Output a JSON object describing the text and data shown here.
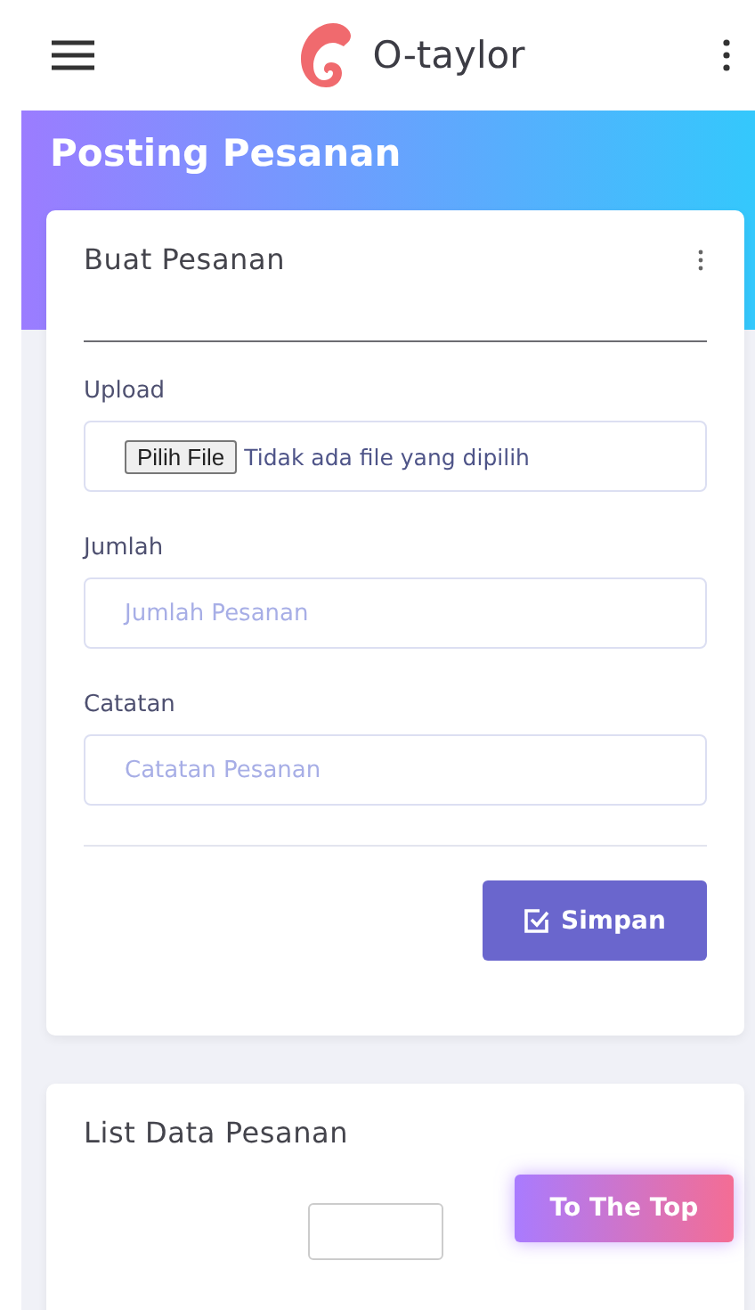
{
  "app_bar": {
    "brand": "O-taylor"
  },
  "page_title": "Posting Pesanan",
  "form_card": {
    "title": "Buat Pesanan",
    "fields": [
      {
        "kind": "file",
        "label": "Upload",
        "button": "Pilih File",
        "value": "Tidak ada file yang dipilih"
      },
      {
        "kind": "text",
        "label": "Jumlah",
        "placeholder": "Jumlah Pesanan"
      },
      {
        "kind": "text",
        "label": "Catatan",
        "placeholder": "Catatan Pesanan"
      }
    ],
    "submit": "Simpan"
  },
  "list_card": {
    "title": "List Data Pesanan"
  },
  "to_top_button": "To The Top"
}
